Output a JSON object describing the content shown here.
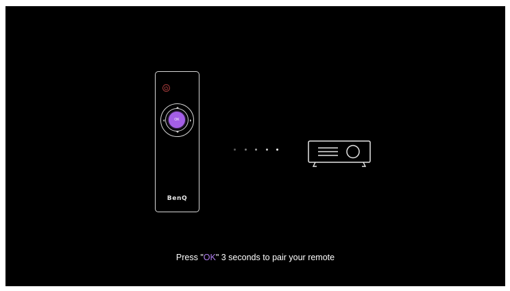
{
  "remote": {
    "brand": "BenQ",
    "ok_label": "OK",
    "power_color": "#a33a3a",
    "ok_color": "#a35ee6"
  },
  "pairing": {
    "dot_count": 5,
    "dot_colors": [
      "#5a5a5a",
      "#7a7a7a",
      "#9c9c9c",
      "#c8c8c8",
      "#ffffff"
    ]
  },
  "instruction": {
    "prefix": "Press \"",
    "key": "OK",
    "suffix": "\" 3 seconds  to pair your remote",
    "key_color": "#b07df0"
  }
}
